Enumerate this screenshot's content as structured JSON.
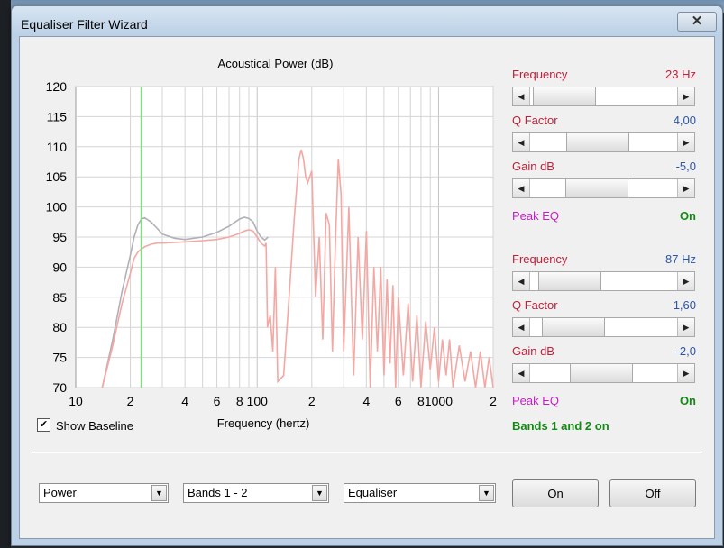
{
  "window": {
    "title": "Equaliser Filter Wizard",
    "close_glyph": "✕"
  },
  "chart_data": {
    "type": "line",
    "title": "Acoustical Power (dB)",
    "xlabel": "Frequency (hertz)",
    "ylabel": "",
    "x_scale": "log",
    "xlim": [
      10,
      200
    ],
    "ylim": [
      70,
      120
    ],
    "x_ticks": [
      {
        "v": 10,
        "t": "10"
      },
      {
        "v": 20,
        "t": "2"
      },
      {
        "v": 40,
        "t": "4"
      },
      {
        "v": 60,
        "t": "6"
      },
      {
        "v": 80,
        "t": "8"
      },
      {
        "v": 100,
        "t": "100"
      },
      {
        "v": 200,
        "t": "2"
      },
      {
        "v": 400,
        "t": "4"
      },
      {
        "v": 600,
        "t": "6"
      },
      {
        "v": 800,
        "t": "8"
      },
      {
        "v": 1000,
        "t": "1000"
      },
      {
        "v": 2000,
        "t": "2"
      }
    ],
    "y_ticks": [
      120,
      115,
      110,
      105,
      100,
      95,
      90,
      85,
      80,
      75,
      70
    ],
    "marker_frequency": 23,
    "series": [
      {
        "color": "#b0b0b8",
        "x": [
          14,
          16,
          18,
          20,
          21,
          22,
          23,
          24,
          26,
          28,
          30,
          35,
          40,
          50,
          60,
          70,
          80,
          85,
          90,
          95,
          100,
          105,
          110,
          115
        ],
        "y": [
          70,
          78,
          86,
          92,
          95,
          97,
          98,
          98.2,
          97.5,
          96.5,
          95.5,
          94.8,
          94.6,
          95,
          95.8,
          96.8,
          98,
          98.3,
          98.1,
          97.5,
          96,
          95,
          94.5,
          95
        ]
      },
      {
        "color": "#f4a8a4",
        "x": [
          14,
          16,
          18,
          20,
          21,
          22,
          23,
          24,
          26,
          28,
          30,
          35,
          40,
          50,
          60,
          70,
          80,
          85,
          90,
          95,
          100,
          105,
          110,
          112,
          114,
          118,
          122,
          126,
          130,
          140,
          150,
          160,
          170,
          175,
          180,
          185,
          190,
          200,
          210,
          220,
          230,
          240,
          250,
          260,
          270,
          280,
          290,
          300,
          320,
          340,
          360,
          380,
          400,
          420,
          440,
          460,
          480,
          500,
          520,
          540,
          560,
          580,
          600,
          640,
          680,
          720,
          760,
          800,
          850,
          900,
          950,
          1000,
          1050,
          1100,
          1150,
          1200,
          1300,
          1400,
          1500,
          1600,
          1700,
          1800,
          1900,
          2000
        ],
        "y": [
          70,
          77,
          84,
          89,
          91.5,
          92.5,
          93,
          93.4,
          93.8,
          94,
          94,
          94.1,
          94.2,
          94.4,
          94.6,
          95,
          95.6,
          96,
          96.2,
          96,
          95,
          94,
          93.5,
          94,
          80,
          82,
          76,
          90,
          71,
          72,
          85,
          98,
          108,
          109.5,
          108,
          105,
          104,
          106,
          85,
          95,
          78,
          99,
          97,
          76,
          94,
          108,
          102,
          76,
          100,
          72,
          95,
          78,
          96,
          70,
          90,
          76,
          90,
          72,
          88,
          74,
          87,
          70,
          85,
          72,
          84,
          71,
          82,
          70,
          81,
          73,
          80,
          71,
          78,
          72,
          78,
          70,
          77,
          71,
          76,
          70,
          76,
          70,
          75,
          70
        ]
      }
    ]
  },
  "controls": {
    "band1": {
      "freq_label": "Frequency",
      "freq_value": "23 Hz",
      "freq_level": 0.04,
      "q_label": "Q Factor",
      "q_value": "4,00",
      "q_level": 0.43,
      "gain_label": "Gain  dB",
      "gain_value": "-5,0",
      "gain_level": 0.42,
      "type_label": "Peak EQ",
      "type_value": "On"
    },
    "band2": {
      "freq_label": "Frequency",
      "freq_value": "87 Hz",
      "freq_level": 0.1,
      "q_label": "Q Factor",
      "q_value": "1,60",
      "q_level": 0.15,
      "gain_label": "Gain  dB",
      "gain_value": "-2,0",
      "gain_level": 0.47,
      "type_label": "Peak EQ",
      "type_value": "On"
    },
    "bands_status": "Bands 1 and 2 on",
    "show_baseline_label": "Show Baseline",
    "show_baseline_checked": "✔"
  },
  "bottom": {
    "combo1": "Power",
    "combo2": "Bands 1 - 2",
    "combo3": "Equaliser",
    "on_button": "On",
    "off_button": "Off",
    "dropdown_glyph": "▼"
  },
  "glyphs": {
    "left": "◀",
    "right": "▶"
  }
}
